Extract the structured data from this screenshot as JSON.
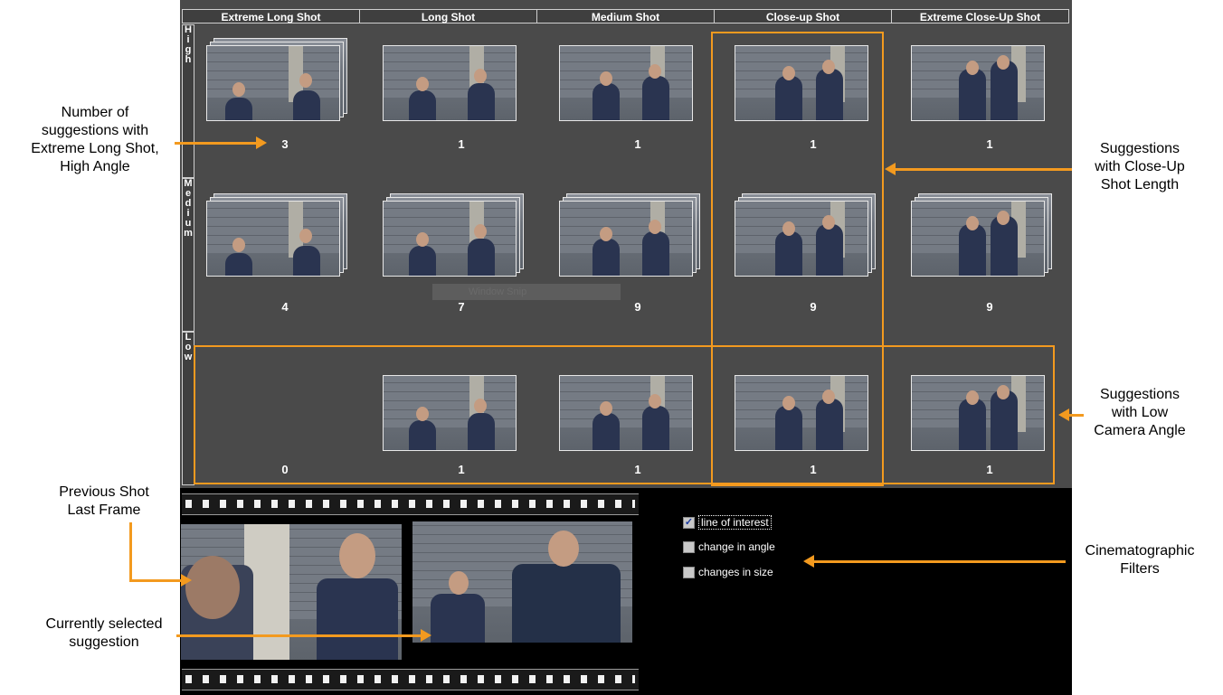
{
  "columns": [
    "Extreme Long Shot",
    "Long Shot",
    "Medium Shot",
    "Close-up Shot",
    "Extreme Close-Up Shot"
  ],
  "rows": [
    {
      "label": "High",
      "counts": [
        "3",
        "1",
        "1",
        "1",
        "1"
      ]
    },
    {
      "label": "Medium",
      "counts": [
        "4",
        "7",
        "9",
        "9",
        "9"
      ]
    },
    {
      "label": "Low",
      "counts": [
        "0",
        "1",
        "1",
        "1",
        "1"
      ]
    }
  ],
  "overlay": {
    "window_snip": "Window Snip"
  },
  "filters": [
    {
      "label": "line of interest",
      "checked": true
    },
    {
      "label": "change in angle",
      "checked": false
    },
    {
      "label": "changes in size",
      "checked": false
    }
  ],
  "annotations": {
    "elhs": "Number of\nsuggestions with\nExtreme Long Shot,\nHigh Angle",
    "closeup": "Suggestions\nwith Close-Up\nShot Length",
    "low": "Suggestions\nwith Low\nCamera Angle",
    "prev": "Previous Shot\nLast Frame",
    "filters": "Cinematographic\nFilters",
    "current": "Currently selected\nsuggestion"
  },
  "colors": {
    "accent": "#f39a1f",
    "panel": "#4a4a4a",
    "filmstrip": "#000000"
  }
}
